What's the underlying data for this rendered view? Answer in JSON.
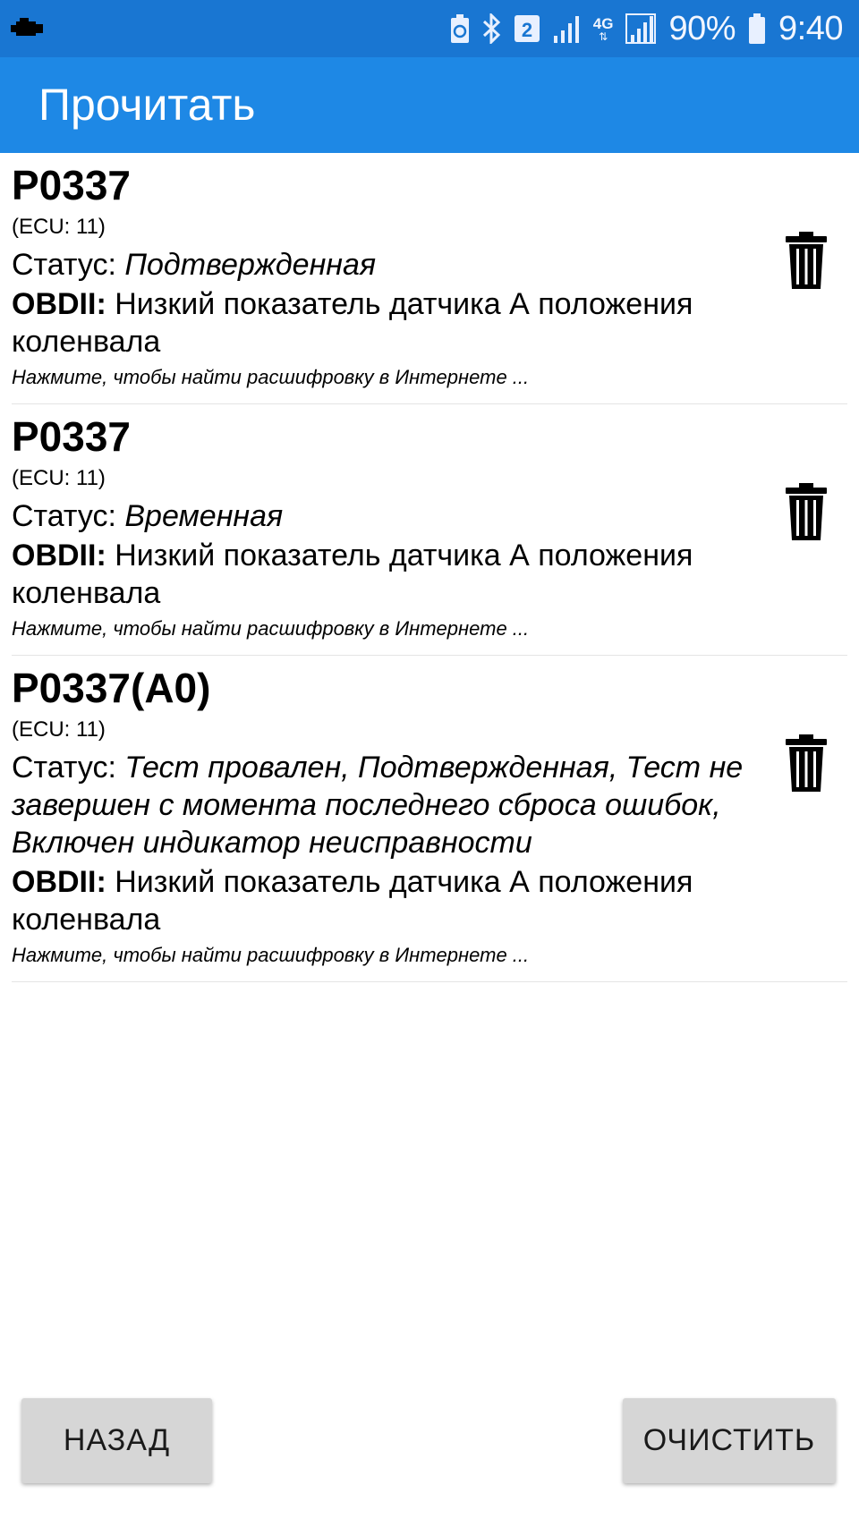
{
  "status_bar": {
    "battery_percent": "90%",
    "time": "9:40",
    "sim_badge": "2",
    "network": "4G",
    "left_icon": "car-engine-icon",
    "right_icons": [
      "battery-saver-icon",
      "bluetooth-icon",
      "sim2-icon",
      "signal-icon",
      "lte-icon",
      "signal-full-icon",
      "battery-icon"
    ]
  },
  "app_bar": {
    "title": "Прочитать",
    "color": "#1e88e5"
  },
  "dtc_items": [
    {
      "code": "P0337",
      "ecu": "(ECU: 11)",
      "status_label": "Статус: ",
      "status_value": "Подтвержденная",
      "obd_label": "OBDII:",
      "description": " Низкий показатель датчика А положения коленвала",
      "hint": "Нажмите, чтобы найти расшифровку в Интернете ..."
    },
    {
      "code": "P0337",
      "ecu": "(ECU: 11)",
      "status_label": "Статус: ",
      "status_value": "Временная",
      "obd_label": "OBDII:",
      "description": " Низкий показатель датчика А положения коленвала",
      "hint": "Нажмите, чтобы найти расшифровку в Интернете ..."
    },
    {
      "code": "P0337(A0)",
      "ecu": "(ECU: 11)",
      "status_label": "Статус: ",
      "status_value": "Тест провален, Подтвержденная, Тест не завершен с момента последнего сброса ошибок, Включен индикатор неисправности",
      "obd_label": "OBDII:",
      "description": " Низкий показатель датчика А положения коленвала",
      "hint": "Нажмите, чтобы найти расшифровку в Интернете ..."
    }
  ],
  "buttons": {
    "back": "НАЗАД",
    "clear": "ОЧИСТИТЬ"
  }
}
